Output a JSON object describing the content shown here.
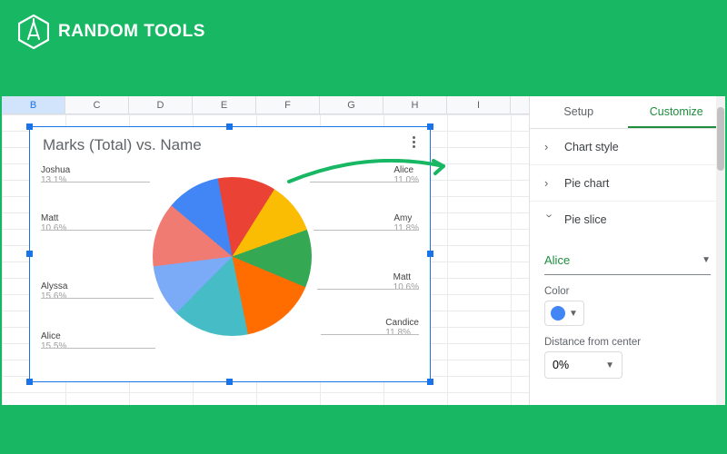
{
  "brand": {
    "name": "RANDOM TOOLS"
  },
  "columns": [
    "B",
    "C",
    "D",
    "E",
    "F",
    "G",
    "H",
    "I"
  ],
  "selected_col": "B",
  "chart": {
    "title": "Marks (Total) vs. Name"
  },
  "chart_data": {
    "type": "pie",
    "title": "Marks (Total) vs. Name",
    "series_name": "Marks (Total)",
    "category_name": "Name",
    "slices": [
      {
        "name": "Alice",
        "pct": 11.0,
        "color": "#4285f4"
      },
      {
        "name": "Amy",
        "pct": 11.8,
        "color": "#ea4335"
      },
      {
        "name": "Matt",
        "pct": 10.6,
        "color": "#fbbc04"
      },
      {
        "name": "Candice",
        "pct": 11.8,
        "color": "#34a853"
      },
      {
        "name": "Alice",
        "pct": 15.5,
        "color": "#ff6d01"
      },
      {
        "name": "Alyssa",
        "pct": 15.6,
        "color": "#46bdc6"
      },
      {
        "name": "Matt",
        "pct": 10.6,
        "color": "#7baaf7"
      },
      {
        "name": "Joshua",
        "pct": 13.1,
        "color": "#f07b72"
      }
    ],
    "leaders_right": [
      {
        "name": "Alice",
        "pct": "11.0%"
      },
      {
        "name": "Amy",
        "pct": "11.8%"
      },
      {
        "name": "Matt",
        "pct": "10.6%"
      },
      {
        "name": "Candice",
        "pct": "11.8%"
      }
    ],
    "leaders_left": [
      {
        "name": "Joshua",
        "pct": "13.1%"
      },
      {
        "name": "Matt",
        "pct": "10.6%"
      },
      {
        "name": "Alyssa",
        "pct": "15.6%"
      },
      {
        "name": "Alice",
        "pct": "15.5%"
      }
    ]
  },
  "panel": {
    "tabs": {
      "setup": "Setup",
      "customize": "Customize",
      "active": "customize"
    },
    "sections": {
      "chart_style": "Chart style",
      "pie_chart": "Pie chart",
      "pie_slice": "Pie slice"
    },
    "slice_selector": {
      "value": "Alice"
    },
    "color": {
      "label": "Color",
      "hex": "#4285f4"
    },
    "distance": {
      "label": "Distance from center",
      "value": "0%"
    }
  }
}
